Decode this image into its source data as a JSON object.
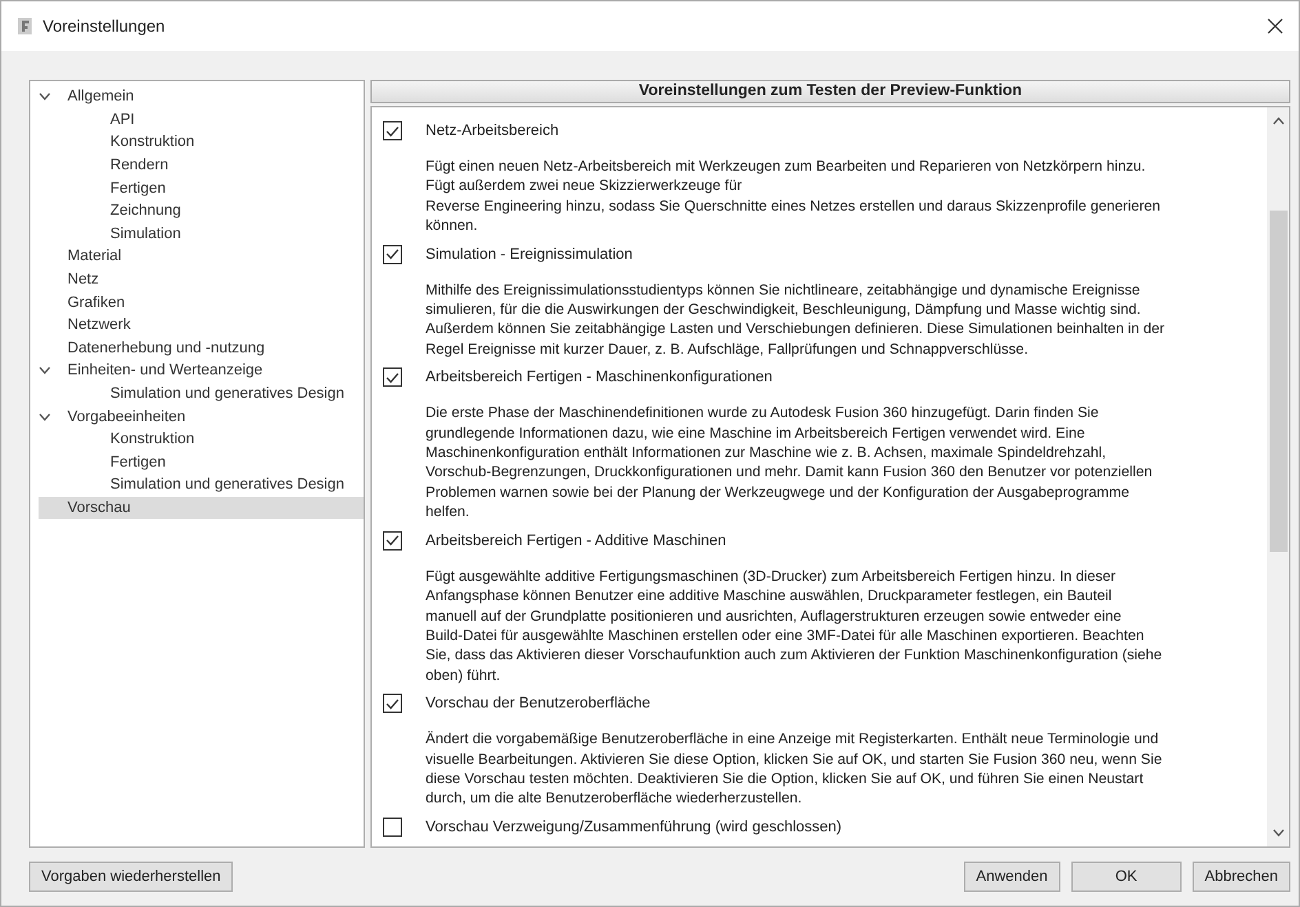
{
  "window": {
    "title": "Voreinstellungen"
  },
  "sidebar": {
    "items": [
      {
        "label": "Allgemein",
        "expanded": true,
        "selected": false,
        "children": [
          {
            "label": "API",
            "selected": false
          },
          {
            "label": "Konstruktion",
            "selected": false
          },
          {
            "label": "Rendern",
            "selected": false
          },
          {
            "label": "Fertigen",
            "selected": false
          },
          {
            "label": "Zeichnung",
            "selected": false
          },
          {
            "label": "Simulation",
            "selected": false
          }
        ]
      },
      {
        "label": "Material",
        "selected": false
      },
      {
        "label": "Netz",
        "selected": false
      },
      {
        "label": "Grafiken",
        "selected": false
      },
      {
        "label": "Netzwerk",
        "selected": false
      },
      {
        "label": "Datenerhebung und -nutzung",
        "selected": false
      },
      {
        "label": "Einheiten- und Werteanzeige",
        "expanded": true,
        "selected": false,
        "children": [
          {
            "label": "Simulation und generatives Design",
            "selected": false
          }
        ]
      },
      {
        "label": "Vorgabeeinheiten",
        "expanded": true,
        "selected": false,
        "children": [
          {
            "label": "Konstruktion",
            "selected": false
          },
          {
            "label": "Fertigen",
            "selected": false
          },
          {
            "label": "Simulation und generatives Design",
            "selected": false
          }
        ]
      },
      {
        "label": "Vorschau",
        "selected": true
      }
    ]
  },
  "panel": {
    "heading": "Voreinstellungen zum Testen der Preview-Funktion",
    "options": [
      {
        "label": "Netz-Arbeitsbereich",
        "checked": true,
        "description": [
          "Fügt einen neuen Netz-Arbeitsbereich mit Werkzeugen zum Bearbeiten und Reparieren von Netzkörpern hinzu.",
          "Fügt außerdem zwei neue Skizzierwerkzeuge für",
          "Reverse Engineering hinzu, sodass Sie Querschnitte eines Netzes erstellen und daraus Skizzenprofile generieren",
          "können."
        ]
      },
      {
        "label": "Simulation - Ereignissimulation",
        "checked": true,
        "description": [
          "Mithilfe des Ereignissimulationsstudientyps können Sie nichtlineare, zeitabhängige und dynamische Ereignisse",
          "simulieren, für die die Auswirkungen der Geschwindigkeit, Beschleunigung, Dämpfung und Masse wichtig sind.",
          "Außerdem können Sie zeitabhängige Lasten und Verschiebungen definieren. Diese Simulationen beinhalten in der",
          "Regel Ereignisse mit kurzer Dauer, z. B. Aufschläge, Fallprüfungen und Schnappverschlüsse."
        ]
      },
      {
        "label": "Arbeitsbereich Fertigen - Maschinenkonfigurationen",
        "checked": true,
        "description": [
          "Die erste Phase der Maschinendefinitionen wurde zu Autodesk Fusion 360 hinzugefügt. Darin finden Sie",
          "grundlegende Informationen dazu, wie eine Maschine im Arbeitsbereich Fertigen verwendet wird. Eine",
          "Maschinenkonfiguration enthält Informationen zur Maschine wie z. B. Achsen, maximale Spindeldrehzahl,",
          "Vorschub-Begrenzungen, Druckkonfigurationen und mehr. Damit kann Fusion 360 den Benutzer vor potenziellen",
          "Problemen warnen sowie bei der Planung der Werkzeugwege und der Konfiguration der Ausgabeprogramme",
          "helfen."
        ]
      },
      {
        "label": "Arbeitsbereich Fertigen - Additive Maschinen",
        "checked": true,
        "description": [
          "Fügt ausgewählte additive Fertigungsmaschinen (3D-Drucker) zum Arbeitsbereich Fertigen hinzu. In dieser",
          "Anfangsphase können Benutzer eine additive Maschine auswählen, Druckparameter festlegen, ein Bauteil",
          "manuell auf der Grundplatte positionieren und ausrichten, Auflagerstrukturen erzeugen sowie entweder eine",
          "Build-Datei für ausgewählte Maschinen erstellen oder eine 3MF-Datei für alle Maschinen exportieren. Beachten",
          "Sie, dass das Aktivieren dieser Vorschaufunktion auch zum Aktivieren der Funktion Maschinenkonfiguration (siehe",
          "oben) führt."
        ]
      },
      {
        "label": "Vorschau der Benutzeroberfläche",
        "checked": true,
        "description": [
          "Ändert die vorgabemäßige Benutzeroberfläche in eine Anzeige mit Registerkarten. Enthält neue Terminologie und",
          "visuelle Bearbeitungen. Aktivieren Sie diese Option, klicken Sie auf OK, und starten Sie Fusion 360 neu, wenn Sie",
          "diese Vorschau testen möchten. Deaktivieren Sie die Option, klicken Sie auf OK, und führen Sie einen Neustart",
          "durch, um die alte Benutzeroberfläche wiederherzustellen."
        ]
      },
      {
        "label": "Vorschau Verzweigung/Zusammenführung (wird geschlossen)",
        "checked": false
      }
    ]
  },
  "buttons": {
    "restore": "Vorgaben wiederherstellen",
    "actions": [
      "Anwenden",
      "OK",
      "Abbrechen"
    ]
  }
}
